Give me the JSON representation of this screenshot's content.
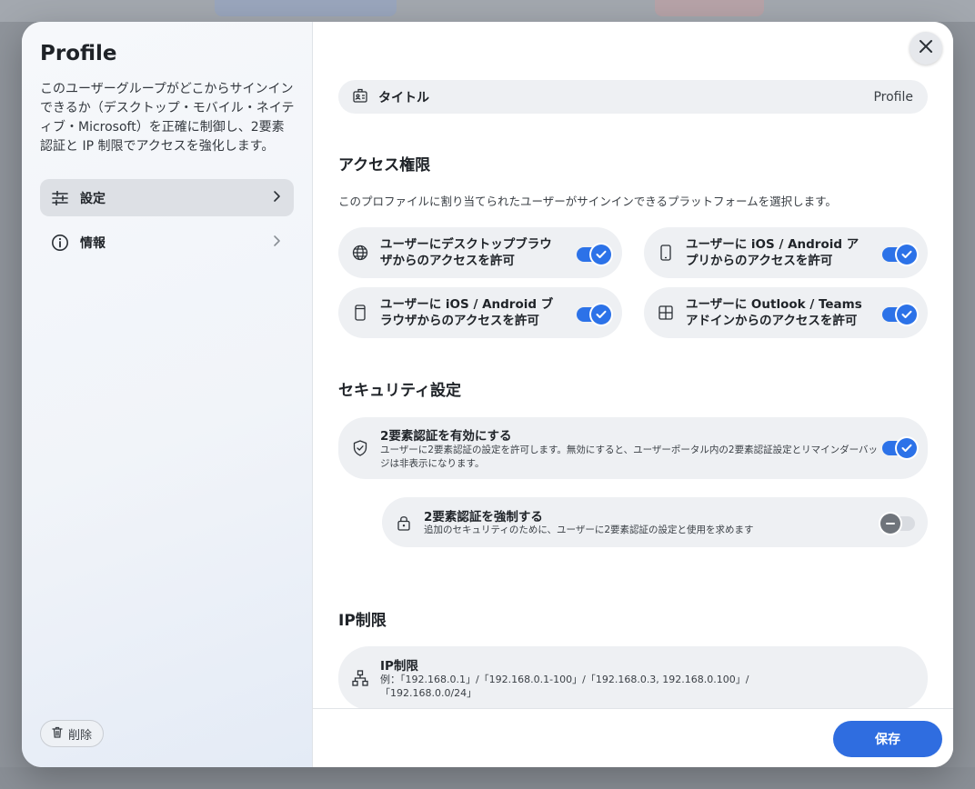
{
  "colors": {
    "accent": "#2c72e8",
    "save_button": "#2f6de0",
    "card_bg": "#eef0f3"
  },
  "sidebar": {
    "title": "Profile",
    "description": "このユーザーグループがどこからサインインできるか（デスクトップ・モバイル・ネイティブ・Microsoft）を正確に制御し、2要素認証と IP 制限でアクセスを強化します。",
    "items": [
      {
        "label": "設定",
        "icon": "sliders-icon",
        "active": true
      },
      {
        "label": "情報",
        "icon": "info-icon",
        "active": false
      }
    ],
    "delete_label": "削除"
  },
  "main": {
    "title_field": {
      "label": "タイトル",
      "value": "Profile",
      "icon": "id-card-icon"
    },
    "access": {
      "heading": "アクセス権限",
      "subtitle": "このプロファイルに割り当てられたユーザーがサインインできるプラットフォームを選択します。",
      "items": [
        {
          "label": "ユーザーにデスクトップブラウザからのアクセスを許可",
          "icon": "globe-icon",
          "enabled": true
        },
        {
          "label": "ユーザーに iOS / Android アプリからのアクセスを許可",
          "icon": "phone-icon",
          "enabled": true
        },
        {
          "label": "ユーザーに iOS / Android ブラウザからのアクセスを許可",
          "icon": "mobile-browser-icon",
          "enabled": true
        },
        {
          "label": "ユーザーに Outlook / Teams アドインからのアクセスを許可",
          "icon": "grid-icon",
          "enabled": true
        }
      ]
    },
    "security": {
      "heading": "セキュリティ設定",
      "two_factor": {
        "title": "2要素認証を有効にする",
        "description": "ユーザーに2要素認証の設定を許可します。無効にすると、ユーザーポータル内の2要素認証設定とリマインダーバッジは非表示になります。",
        "enabled": true
      },
      "enforce": {
        "title": "2要素認証を強制する",
        "description": "追加のセキュリティのために、ユーザーに2要素認証の設定と使用を求めます",
        "enabled": false
      }
    },
    "ip": {
      "heading": "IP制限",
      "item_title": "IP制限",
      "example": "例：「192.168.0.1」/「192.168.0.1-100」/「192.168.0.3, 192.168.0.100」/「192.168.0.0/24」"
    }
  },
  "footer": {
    "save_label": "保存"
  }
}
